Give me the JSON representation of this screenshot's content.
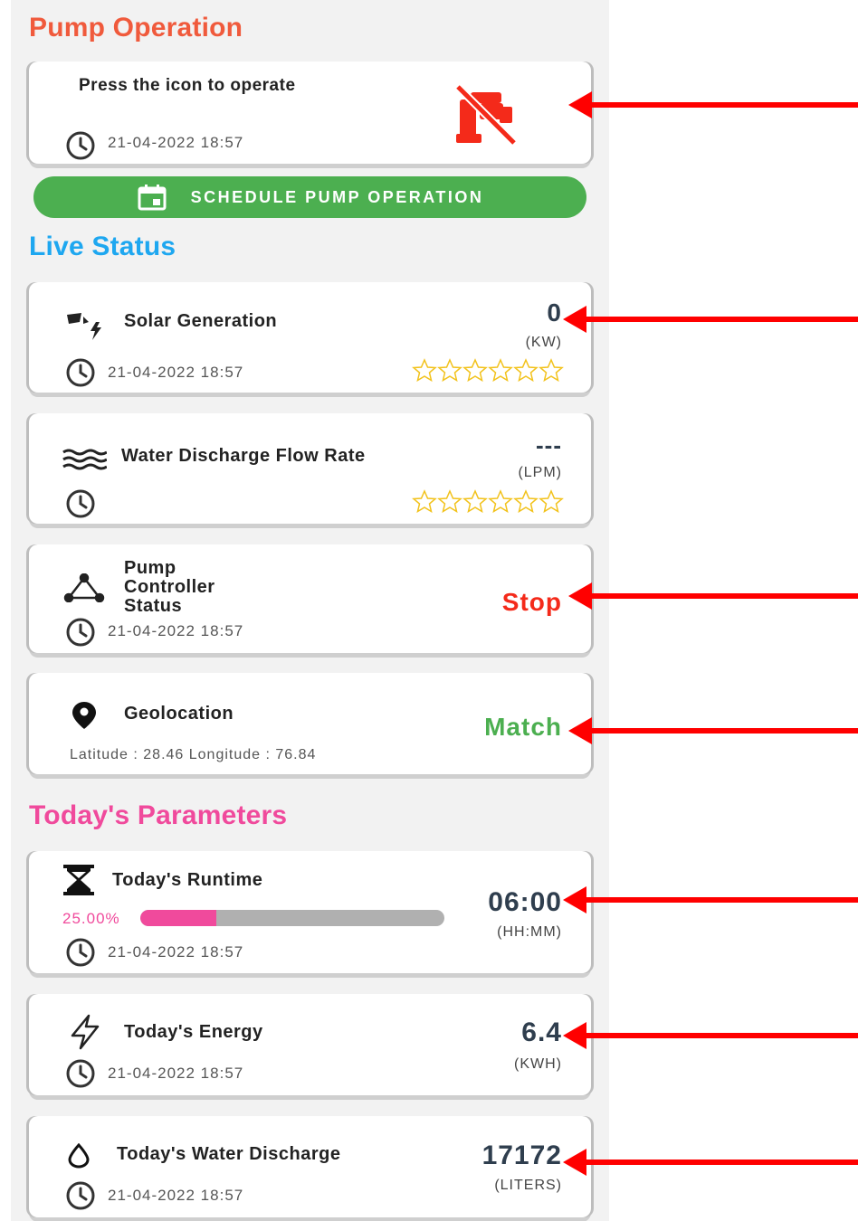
{
  "colors": {
    "pump_title": "#f05a3c",
    "live_title": "#1ea7f0",
    "params_title": "#f04a9c",
    "accent_green": "#4caf50",
    "stop_red": "#f42a1a",
    "annotation_arrow": "#ff0000"
  },
  "pump_operation": {
    "title": "Pump Operation",
    "card_label": "Press the icon to operate",
    "timestamp": "21-04-2022 18:57",
    "icon": "pump-off-icon",
    "schedule_button": "SCHEDULE PUMP OPERATION",
    "schedule_icon": "calendar-icon"
  },
  "live_status": {
    "title": "Live Status",
    "solar": {
      "label": "Solar Generation",
      "value": "0",
      "unit": "(KW)",
      "timestamp": "21-04-2022 18:57",
      "rating": 0,
      "icon": "solar-power-icon"
    },
    "water_flow": {
      "label": "Water Discharge Flow Rate",
      "value": "---",
      "unit": "(LPM)",
      "timestamp": "",
      "rating": 0,
      "icon": "waves-icon"
    },
    "controller": {
      "label_line1": "Pump",
      "label_line2": "Controller",
      "label_line3": "Status",
      "value": "Stop",
      "timestamp": "21-04-2022 18:57",
      "icon": "network-icon"
    },
    "geolocation": {
      "label": "Geolocation",
      "value": "Match",
      "coords": "Latitude : 28.46  Longitude : 76.84",
      "icon": "location-pin-icon"
    }
  },
  "todays_parameters": {
    "title": "Today's Parameters",
    "runtime": {
      "label": "Today's Runtime",
      "value": "06:00",
      "unit": "(HH:MM)",
      "percent_text": "25.00%",
      "progress": 0.25,
      "timestamp": "21-04-2022 18:57",
      "icon": "hourglass-icon"
    },
    "energy": {
      "label": "Today's Energy",
      "value": "6.4",
      "unit": "(KWH)",
      "timestamp": "21-04-2022 18:57",
      "icon": "lightning-icon"
    },
    "water_discharge": {
      "label": "Today's Water Discharge",
      "value": "17172",
      "unit": "(LITERS)",
      "timestamp": "21-04-2022 18:57",
      "icon": "water-drop-icon"
    }
  }
}
